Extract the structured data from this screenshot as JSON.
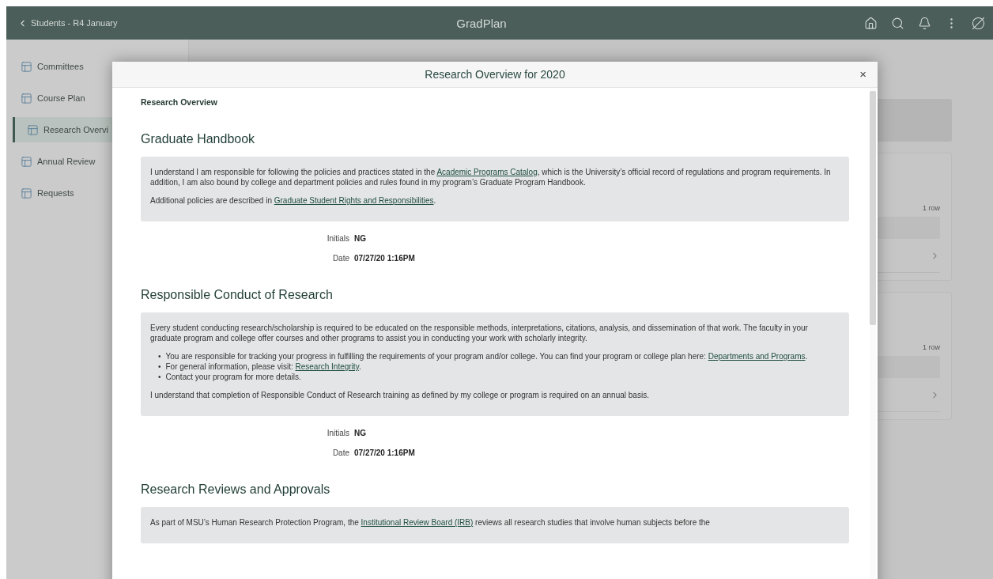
{
  "header": {
    "back_label": "Students - R4 January",
    "title": "GradPlan"
  },
  "sidebar": {
    "items": [
      {
        "label": "Committees",
        "selected": false
      },
      {
        "label": "Course Plan",
        "selected": false
      },
      {
        "label": "Research Overvi",
        "selected": true
      },
      {
        "label": "Annual Review",
        "selected": false
      },
      {
        "label": "Requests",
        "selected": false
      }
    ]
  },
  "background_cards": [
    {
      "count": "1 row"
    },
    {
      "count": "1 row"
    }
  ],
  "modal": {
    "title": "Research Overview for 2020",
    "close": "×",
    "subtitle": "Research Overview",
    "sections": [
      {
        "heading": "Graduate Handbook",
        "blocks": [
          {
            "kind": "paragraph",
            "parts": [
              {
                "kind": "text",
                "text": "I understand I am responsible for following the policies and practices stated in the "
              },
              {
                "kind": "link",
                "text": "Academic Programs Catalog"
              },
              {
                "kind": "text",
                "text": ", which is the University’s official record of regulations and program requirements. In addition, I am also bound by college and department policies and rules found in my program’s Graduate Program Handbook."
              }
            ]
          },
          {
            "kind": "paragraph",
            "parts": [
              {
                "kind": "text",
                "text": "Additional policies are described in "
              },
              {
                "kind": "link",
                "text": "Graduate Student Rights and Responsibilities"
              },
              {
                "kind": "text",
                "text": "."
              }
            ]
          }
        ],
        "signature": [
          {
            "label": "Initials",
            "value": "NG"
          },
          {
            "label": "Date",
            "value": "07/27/20 1:16PM"
          }
        ]
      },
      {
        "heading": "Responsible Conduct of Research",
        "blocks": [
          {
            "kind": "paragraph",
            "parts": [
              {
                "kind": "text",
                "text": "Every student conducting research/scholarship is required to be educated on the responsible methods, interpretations, citations, analysis, and dissemination of that work. The faculty in your graduate program and college offer courses and other programs to assist you in conducting your work with scholarly integrity."
              }
            ]
          },
          {
            "kind": "list",
            "items": [
              {
                "marker": "•",
                "parts": [
                  {
                    "kind": "text",
                    "text": "You are responsible for tracking your progress in fulfilling the requirements of your program and/or college. You can find your program or college plan here: "
                  },
                  {
                    "kind": "link",
                    "text": "Departments and Programs"
                  },
                  {
                    "kind": "text",
                    "text": "."
                  }
                ]
              },
              {
                "marker": "•",
                "parts": [
                  {
                    "kind": "text",
                    "text": "For general information, please visit: "
                  },
                  {
                    "kind": "link",
                    "text": "Research Integrity"
                  },
                  {
                    "kind": "text",
                    "text": "."
                  }
                ]
              },
              {
                "marker": "•",
                "parts": [
                  {
                    "kind": "text",
                    "text": "Contact your program for more details."
                  }
                ]
              }
            ]
          },
          {
            "kind": "paragraph",
            "parts": [
              {
                "kind": "text",
                "text": "I understand that completion of Responsible Conduct of Research training as defined by my college or program is required on an annual basis."
              }
            ]
          }
        ],
        "signature": [
          {
            "label": "Initials",
            "value": "NG"
          },
          {
            "label": "Date",
            "value": "07/27/20 1:16PM"
          }
        ]
      },
      {
        "heading": "Research Reviews and Approvals",
        "blocks": [
          {
            "kind": "paragraph",
            "parts": [
              {
                "kind": "text",
                "text": "As part of MSU’s Human Research Protection Program, the "
              },
              {
                "kind": "link",
                "text": "Institutional Review Board (IRB)"
              },
              {
                "kind": "text",
                "text": " reviews all research studies that involve human subjects before the"
              }
            ]
          }
        ]
      }
    ]
  }
}
